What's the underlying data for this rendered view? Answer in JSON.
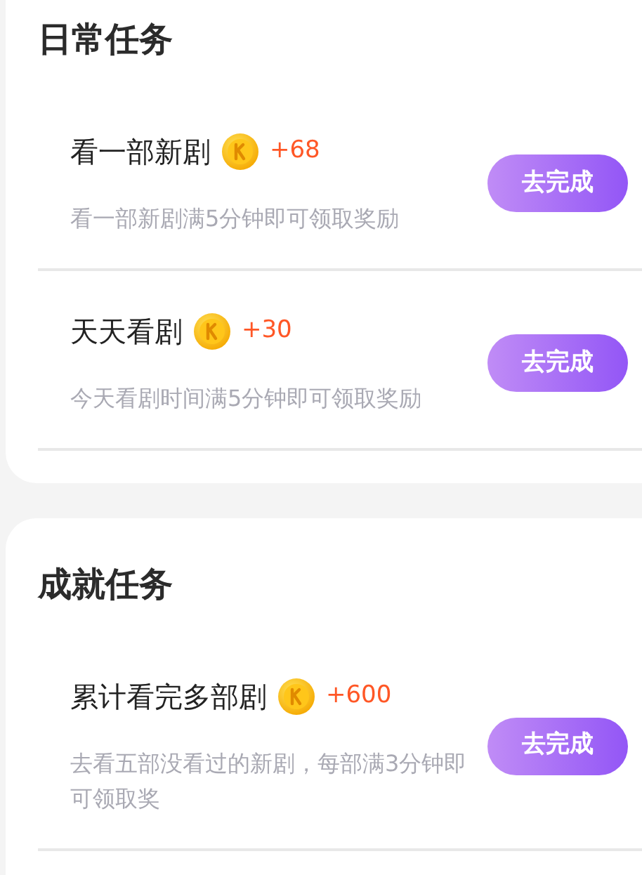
{
  "sections": [
    {
      "title": "日常任务",
      "tasks": [
        {
          "title": "看一部新剧",
          "reward": "+68",
          "description": "看一部新剧满5分钟即可领取奖励",
          "button": "去完成"
        },
        {
          "title": "天天看剧",
          "reward": "+30",
          "description": "今天看剧时间满5分钟即可领取奖励",
          "button": "去完成"
        }
      ]
    },
    {
      "title": "成就任务",
      "tasks": [
        {
          "title": "累计看完多部剧",
          "reward": "+600",
          "description": "去看五部没看过的新剧，每部满3分钟即可领取奖",
          "button": "去完成"
        }
      ]
    }
  ]
}
